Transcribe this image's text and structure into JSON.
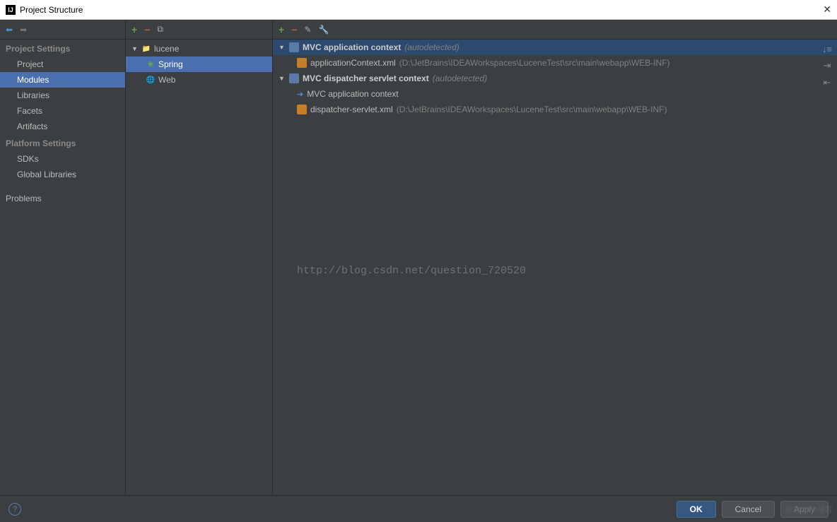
{
  "window": {
    "title": "Project Structure"
  },
  "sidebar": {
    "sections": {
      "project_settings": {
        "label": "Project Settings",
        "items": [
          "Project",
          "Modules",
          "Libraries",
          "Facets",
          "Artifacts"
        ]
      },
      "platform_settings": {
        "label": "Platform Settings",
        "items": [
          "SDKs",
          "Global Libraries"
        ]
      },
      "problems": "Problems"
    },
    "selected": "Modules"
  },
  "modules_tree": {
    "root": {
      "name": "lucene",
      "expanded": true,
      "children": [
        {
          "name": "Spring",
          "icon": "spring",
          "selected": true
        },
        {
          "name": "Web",
          "icon": "web"
        }
      ]
    }
  },
  "contexts": [
    {
      "title": "MVC application context",
      "hint": "(autodetected)",
      "selected": true,
      "children": [
        {
          "type": "xml",
          "name": "applicationContext.xml",
          "path": "(D:\\JetBrains\\IDEAWorkspaces\\LuceneTest\\src\\main\\webapp\\WEB-INF)"
        }
      ]
    },
    {
      "title": "MVC dispatcher servlet context",
      "hint": "(autodetected)",
      "children": [
        {
          "type": "link",
          "name": "MVC application context"
        },
        {
          "type": "xml",
          "name": "dispatcher-servlet.xml",
          "path": "(D:\\JetBrains\\IDEAWorkspaces\\LuceneTest\\src\\main\\webapp\\WEB-INF)"
        }
      ]
    }
  ],
  "watermark": "http://blog.csdn.net/question_720520",
  "footer": {
    "ok": "OK",
    "cancel": "Cancel",
    "apply": "Apply"
  },
  "corner_watermark": "@51CTO博客"
}
